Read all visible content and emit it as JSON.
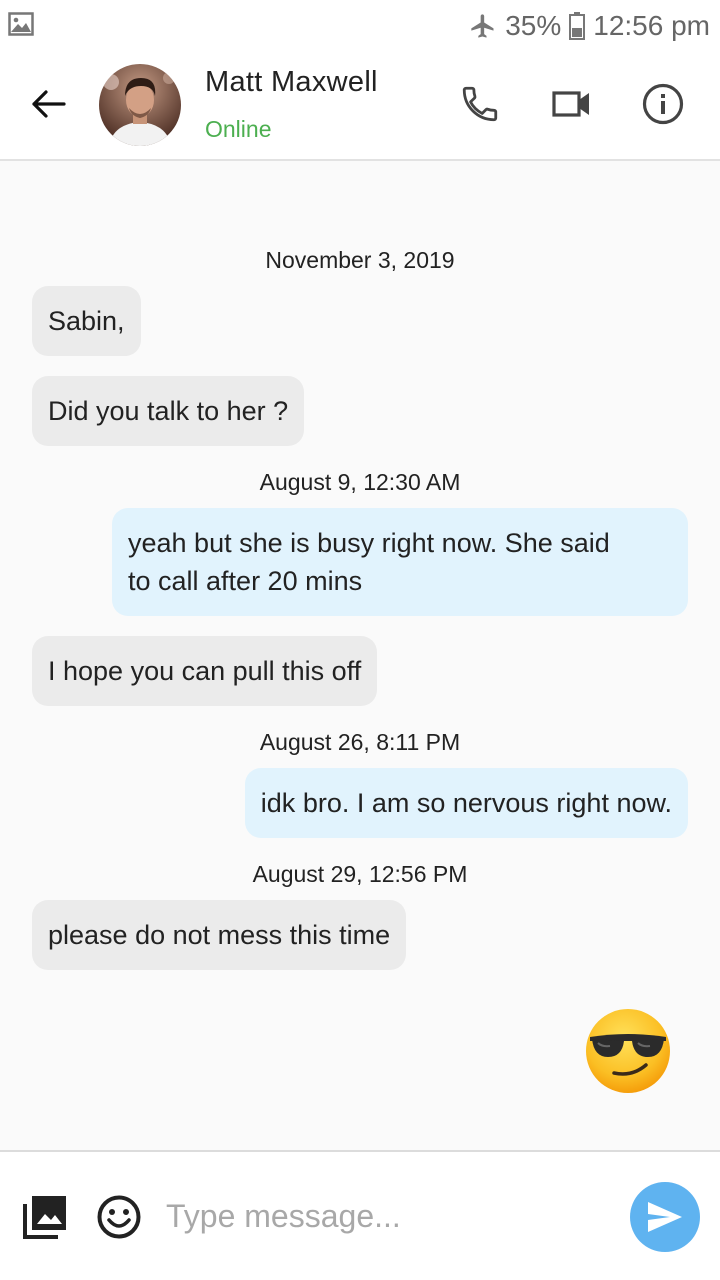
{
  "status_bar": {
    "battery": "35%",
    "time": "12:56 pm",
    "icons": [
      "image-notification-icon",
      "airplane-mode-icon",
      "battery-icon"
    ]
  },
  "header": {
    "contact_name": "Matt Maxwell",
    "contact_status": "Online",
    "icons": [
      "back-arrow-icon",
      "phone-icon",
      "video-camera-icon",
      "info-icon"
    ]
  },
  "messages": [
    {
      "type": "date",
      "text": "November 3, 2019"
    },
    {
      "type": "incoming",
      "text": "Sabin,"
    },
    {
      "type": "incoming",
      "text": "Did you talk to her ?"
    },
    {
      "type": "date",
      "text": "August 9, 12:30 AM"
    },
    {
      "type": "outgoing",
      "line1": "yeah but she is busy right now. She said",
      "line2": "to call after 20 mins"
    },
    {
      "type": "incoming",
      "text": "I hope you can pull this off"
    },
    {
      "type": "date",
      "text": "August 26, 8:11 PM"
    },
    {
      "type": "outgoing",
      "text": "idk bro. I am so nervous right now."
    },
    {
      "type": "date",
      "text": "August 29, 12:56 PM"
    },
    {
      "type": "incoming",
      "text": "please do not mess this time"
    },
    {
      "type": "sticker",
      "icon": "sunglasses-emoji-icon"
    }
  ],
  "input_bar": {
    "placeholder": "Type message...",
    "value": "",
    "icons": [
      "gallery-icon",
      "emoji-picker-icon",
      "send-icon"
    ]
  },
  "colors": {
    "online": "#4caf50",
    "incoming_bubble": "#ebebeb",
    "outgoing_bubble": "#e1f3fd",
    "send_button": "#5fb3f0"
  }
}
